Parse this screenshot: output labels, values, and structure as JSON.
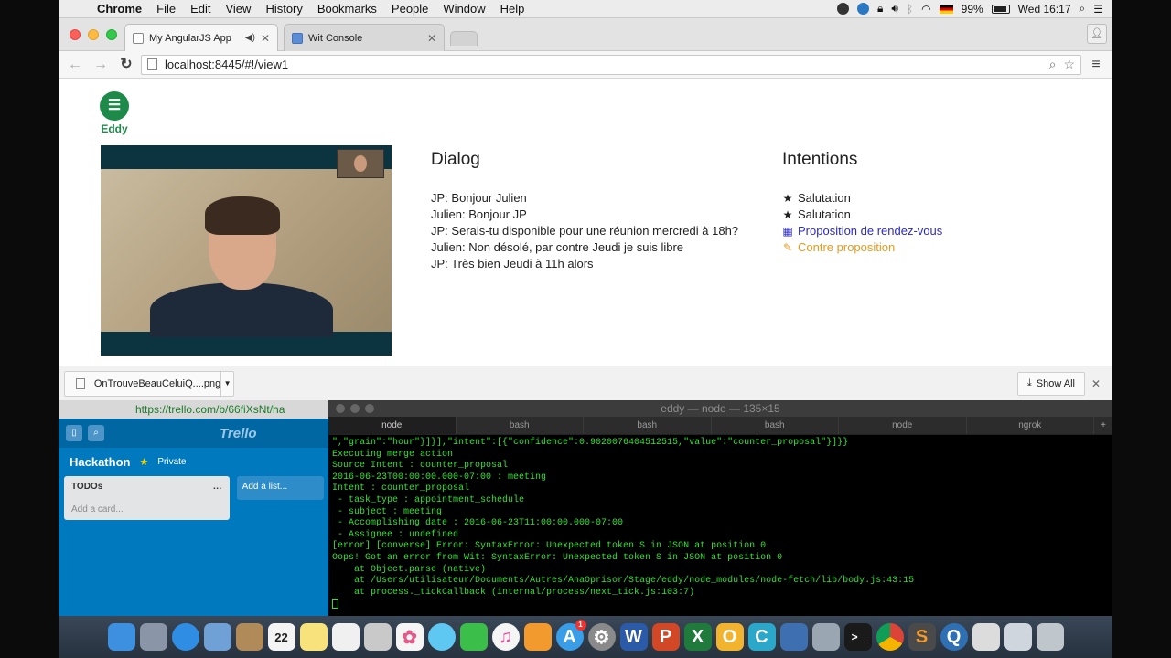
{
  "menubar": {
    "app_name": "Chrome",
    "items": [
      "File",
      "Edit",
      "View",
      "History",
      "Bookmarks",
      "People",
      "Window",
      "Help"
    ],
    "battery": "99%",
    "clock": "Wed 16:17"
  },
  "browser": {
    "tabs": [
      {
        "title": "My AngularJS App",
        "active": true
      },
      {
        "title": "Wit Console",
        "active": false
      }
    ],
    "url": "localhost:8445/#!/view1"
  },
  "page": {
    "logo_text": "Eddy",
    "dialog": {
      "title": "Dialog",
      "lines": [
        "JP: Bonjour Julien",
        "Julien: Bonjour JP",
        "JP: Serais-tu disponible pour une réunion mercredi à 18h?",
        "Julien: Non désolé, par contre Jeudi je suis libre",
        "JP: Très bien Jeudi à 11h alors"
      ]
    },
    "intentions": {
      "title": "Intentions",
      "items": [
        {
          "icon": "star-icon",
          "label": "Salutation",
          "color": "#222222"
        },
        {
          "icon": "star-icon",
          "label": "Salutation",
          "color": "#222222"
        },
        {
          "icon": "calendar-icon",
          "label": "Proposition de rendez-vous",
          "color": "#2a2ac4"
        },
        {
          "icon": "pencil-icon",
          "label": "Contre proposition",
          "color": "#e69a1d"
        }
      ]
    }
  },
  "downloads": {
    "file_name": "OnTrouveBeauCeluiQ....png",
    "show_all": "Show All"
  },
  "trello": {
    "url": "https://trello.com/b/66fiXsNt/ha",
    "brand": "Trello",
    "board_name": "Hackathon",
    "privacy": "Private",
    "list_title": "TODOs",
    "add_card": "Add a card...",
    "add_list": "Add a list..."
  },
  "terminal": {
    "title": "eddy — node — 135×15",
    "tabs": [
      "node",
      "bash",
      "bash",
      "bash",
      "node",
      "ngrok"
    ],
    "lines": [
      "\",\"grain\":\"hour\"}]}],\"intent\":[{\"confidence\":0.9020076404512515,\"value\":\"counter_proposal\"}]}}",
      "Executing merge action",
      "Source Intent : counter_proposal",
      "2016-06-23T00:00:00.000-07:00 : meeting",
      "Intent : counter_proposal",
      " - task_type : appointment_schedule",
      " - subject : meeting",
      " - Accomplishing date : 2016-06-23T11:00:00.000-07:00",
      " - Assignee : undefined",
      "[error] [converse] Error: SyntaxError: Unexpected token S in JSON at position 0",
      "Oops! Got an error from Wit: SyntaxError: Unexpected token S in JSON at position 0",
      "    at Object.parse (native)",
      "    at /Users/utilisateur/Documents/Autres/AnaOprisor/Stage/eddy/node_modules/node-fetch/lib/body.js:43:15",
      "    at process._tickCallback (internal/process/next_tick.js:103:7)"
    ]
  },
  "dock": {
    "date_number": "22",
    "badge": "1",
    "app_letters": [
      "W",
      "P",
      "X",
      "O",
      "C"
    ]
  }
}
